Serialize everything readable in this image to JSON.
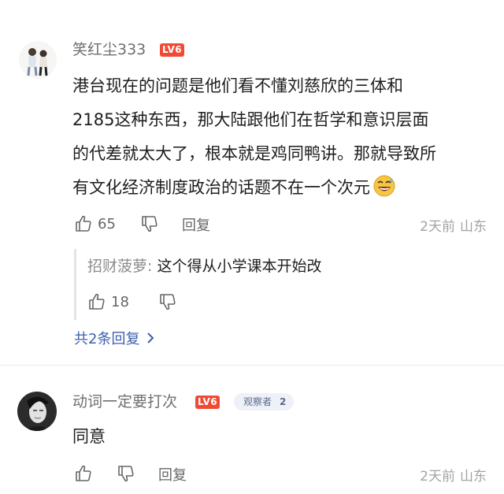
{
  "comment1": {
    "username": "笑红尘333",
    "level": "LV6",
    "lines": [
      "港台现在的问题是他们看不懂刘慈欣的三体和",
      "2185这种东西，那大陆跟他们在哲学和意识层面",
      "的代差就太大了，根本就是鸡同鸭讲。那就导致所",
      "有文化经济制度政治的话题不在一个次元"
    ],
    "emoji": "grin-sweat-emoji",
    "likes": "65",
    "reply_label": "回复",
    "time": "2天前",
    "location": "山东",
    "sub_reply": {
      "user": "招财菠萝",
      "colon": ": ",
      "text": "这个得从小学课本开始改",
      "likes": "18"
    },
    "more_replies": "共2条回复"
  },
  "comment2": {
    "username": "动词一定要打次",
    "level": "LV6",
    "role": "观察者",
    "role_num": "2",
    "text": "同意",
    "reply_label": "回复",
    "time": "2天前",
    "location": "山东"
  },
  "colors": {
    "level_badge": "#f04a35",
    "link": "#3d5fae",
    "meta": "#a3a3a3"
  }
}
